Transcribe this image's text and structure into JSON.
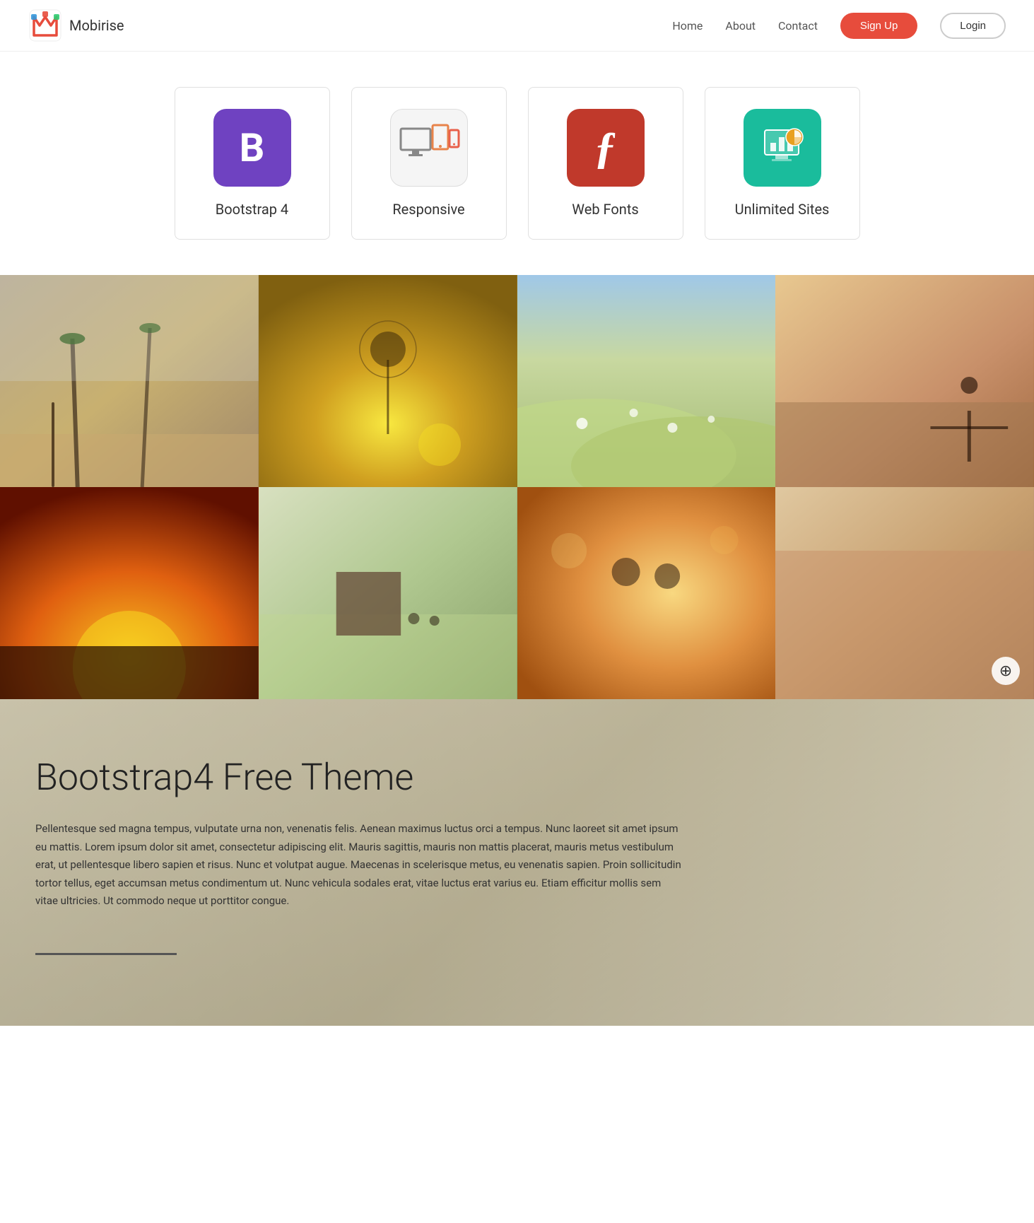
{
  "navbar": {
    "brand": {
      "name": "Mobirise"
    },
    "links": [
      {
        "label": "Home",
        "href": "#"
      },
      {
        "label": "About",
        "href": "#"
      },
      {
        "label": "Contact",
        "href": "#"
      }
    ],
    "signup_label": "Sign Up",
    "login_label": "Login"
  },
  "features": [
    {
      "id": "bootstrap",
      "icon": "B",
      "icon_class": "icon-bootstrap",
      "label": "Bootstrap 4"
    },
    {
      "id": "responsive",
      "icon": "📱",
      "icon_class": "icon-responsive",
      "label": "Responsive"
    },
    {
      "id": "webfonts",
      "icon": "ƒ",
      "icon_class": "icon-webfonts",
      "label": "Web Fonts"
    },
    {
      "id": "unlimited",
      "icon": "📊",
      "icon_class": "icon-unlimited",
      "label": "Unlimited Sites"
    }
  ],
  "gallery": {
    "zoom_icon": "⊕"
  },
  "content": {
    "title": "Bootstrap4 Free Theme",
    "body": "Pellentesque sed magna tempus, vulputate urna non, venenatis felis. Aenean maximus luctus orci a tempus. Nunc laoreet sit amet ipsum eu mattis. Lorem ipsum dolor sit amet, consectetur adipiscing elit. Mauris sagittis, mauris non mattis placerat, mauris metus vestibulum erat, ut pellentesque libero sapien et risus. Nunc et volutpat augue. Maecenas in scelerisque metus, eu venenatis sapien. Proin sollicitudin tortor tellus, eget accumsan metus condimentum ut. Nunc vehicula sodales erat, vitae luctus erat varius eu. Etiam efficitur mollis sem vitae ultricies. Ut commodo neque ut porttitor congue."
  }
}
